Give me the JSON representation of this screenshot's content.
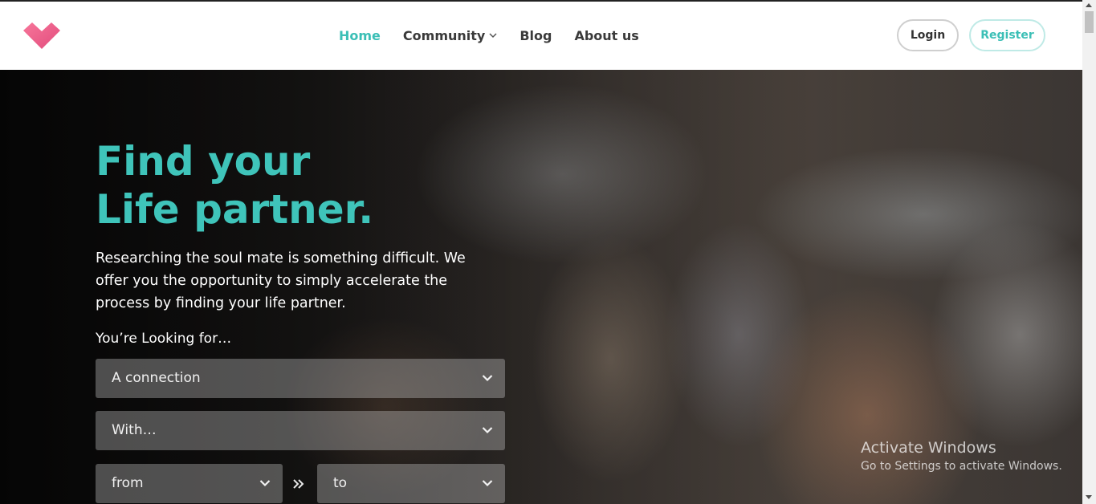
{
  "header": {
    "nav": [
      {
        "label": "Home",
        "active": true
      },
      {
        "label": "Community",
        "has_dropdown": true
      },
      {
        "label": "Blog"
      },
      {
        "label": "About us"
      }
    ],
    "login_label": "Login",
    "register_label": "Register"
  },
  "hero": {
    "title_line1": "Find your",
    "title_line2": "Life partner.",
    "description": "Researching the soul mate is something difficult. We offer you the opportunity to simply accelerate the process by finding your life partner.",
    "looking_label": "You’re Looking for…",
    "selects": {
      "connection": "A connection",
      "with": "With…",
      "from": "from",
      "to": "to"
    }
  },
  "watermark": {
    "title": "Activate Windows",
    "subtitle": "Go to Settings to activate Windows."
  },
  "colors": {
    "accent": "#3fc4ba",
    "logo_pink": "#f0608a"
  },
  "icons": [
    "heart-logo-icon",
    "chevron-down-icon",
    "double-chevron-right-icon"
  ]
}
